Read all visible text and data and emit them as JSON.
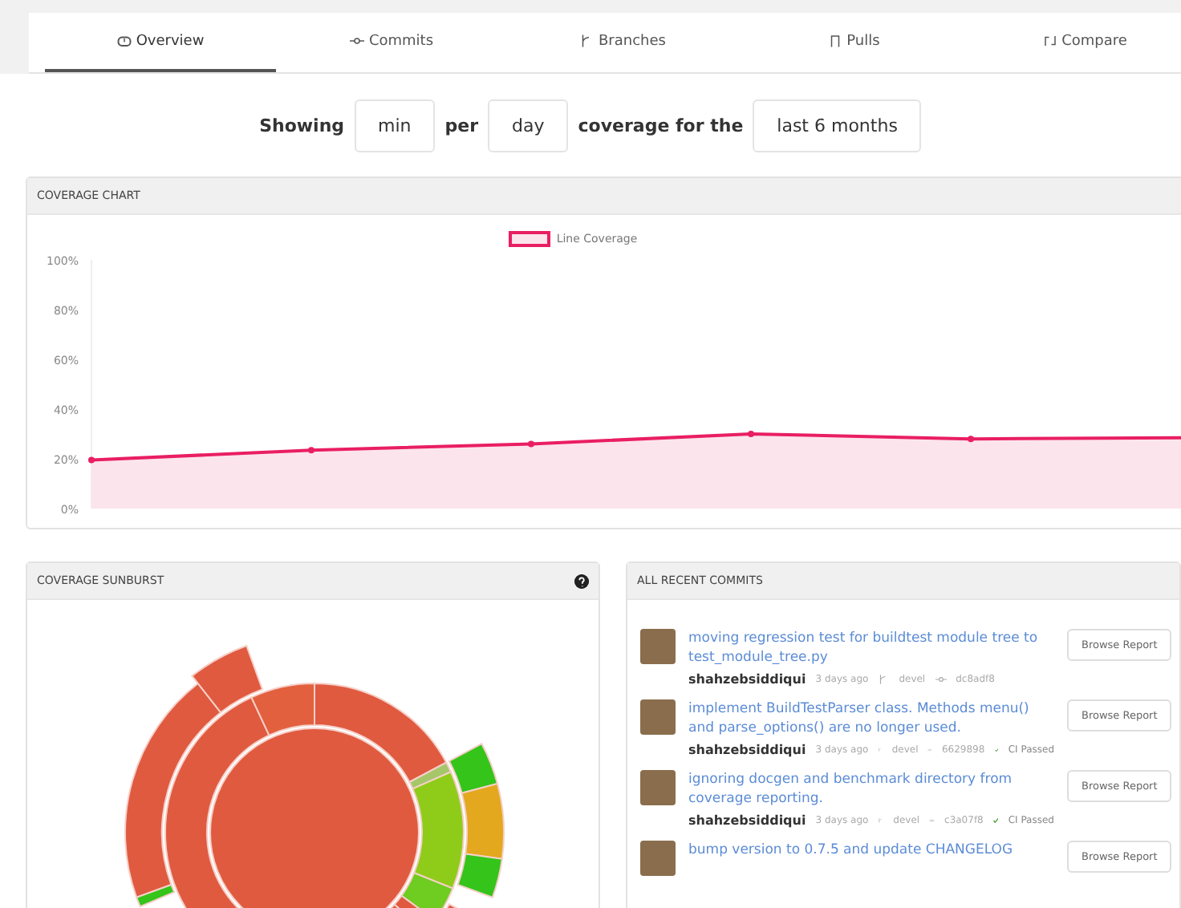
{
  "tabs": [
    {
      "label": "Overview",
      "selected": true
    },
    {
      "label": "Commits",
      "selected": false
    },
    {
      "label": "Branches",
      "selected": false
    },
    {
      "label": "Pulls",
      "selected": false
    },
    {
      "label": "Compare",
      "selected": false
    }
  ],
  "filter": {
    "showing": "Showing",
    "method": "min",
    "per": "per",
    "interval": "day",
    "coverage_for": "coverage for the",
    "range": "last 6 months"
  },
  "coverage_chart": {
    "title": "COVERAGE CHART",
    "chart_data": {
      "type": "area",
      "ylim": [
        0,
        100
      ],
      "yticks": [
        {
          "value": 0,
          "label": "0%"
        },
        {
          "value": 20,
          "label": "20%"
        },
        {
          "value": 40,
          "label": "40%"
        },
        {
          "value": 60,
          "label": "60%"
        },
        {
          "value": 80,
          "label": "80%"
        },
        {
          "value": 100,
          "label": "100%"
        }
      ],
      "series": [
        {
          "name": "Line Coverage",
          "color": "#e91e63",
          "values": [
            19.5,
            23.5,
            26,
            30,
            28,
            28.5
          ]
        }
      ]
    }
  },
  "sunburst": {
    "title": "COVERAGE SUNBURST"
  },
  "recent_commits": {
    "title": "ALL RECENT COMMITS",
    "commits": [
      {
        "message": "moving regression test for buildtest module tree to test_module_tree.py",
        "author": "shahzebsiddiqui",
        "time": "3 days ago",
        "branch": "devel",
        "sha": "dc8adf8",
        "ci_passed": false,
        "button": "Browse Report"
      },
      {
        "message": "implement BuildTestParser class. Methods menu() and parse_options() are no longer used.",
        "author": "shahzebsiddiqui",
        "time": "3 days ago",
        "branch": "devel",
        "sha": "6629898",
        "ci_passed": true,
        "ci_label": "CI Passed",
        "button": "Browse Report"
      },
      {
        "message": "ignoring docgen and benchmark directory from coverage reporting.",
        "author": "shahzebsiddiqui",
        "time": "3 days ago",
        "branch": "devel",
        "sha": "c3a07f8",
        "ci_passed": true,
        "ci_label": "CI Passed",
        "button": "Browse Report"
      },
      {
        "message": "bump version to 0.7.5 and update CHANGELOG",
        "button": "Browse Report"
      }
    ]
  }
}
